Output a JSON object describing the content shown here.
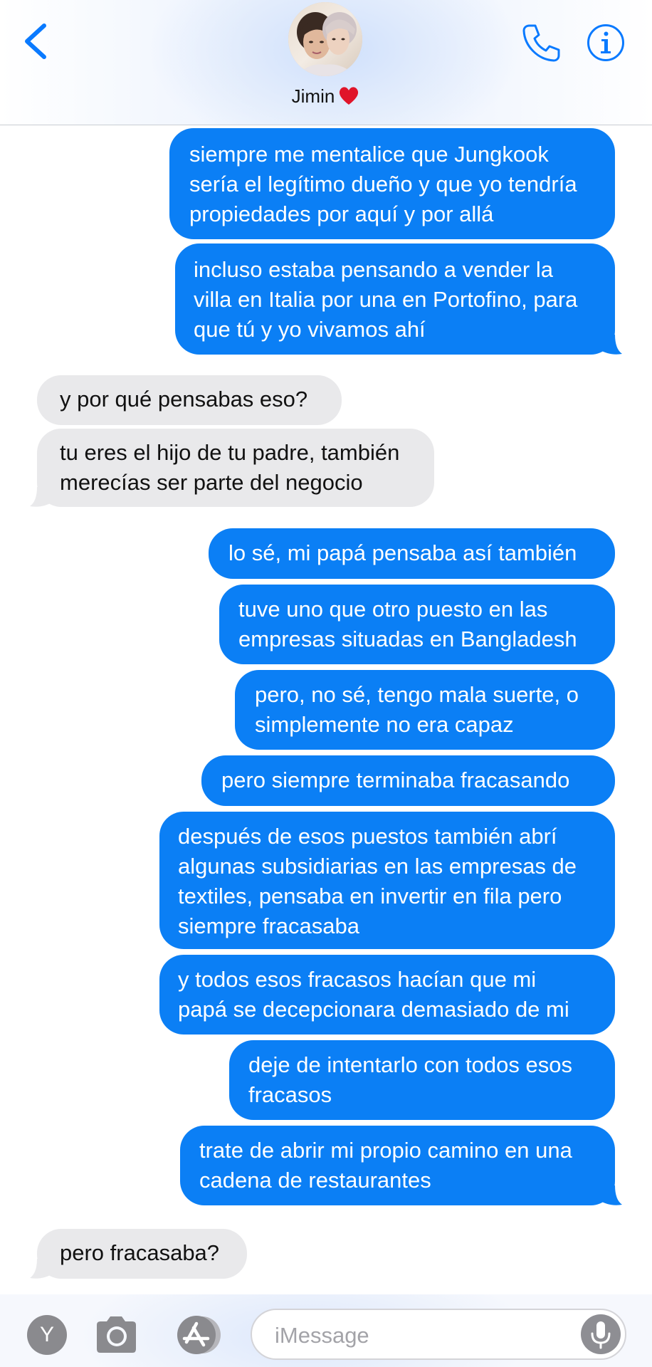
{
  "header": {
    "contact_name": "Jimin",
    "heart_emoji": "heart-emoji",
    "icons": [
      "chevron-left-icon",
      "phone-icon",
      "info-icon"
    ],
    "accent_color": "#0a7aff"
  },
  "messages": [
    {
      "from": "me",
      "lines": [
        "siempre me mentalice que Jungkook",
        "sería el legítimo dueño y que yo tendría",
        "propiedades por aquí y por allá"
      ]
    },
    {
      "from": "me",
      "lines": [
        "incluso estaba pensando a vender la",
        "villa en Italia por una en Portofino, para",
        "que tú y yo vivamos ahí"
      ]
    },
    {
      "from": "them",
      "lines": [
        "y por qué pensabas eso?"
      ]
    },
    {
      "from": "them",
      "lines": [
        "tu eres el hijo de tu padre, también",
        "merecías ser parte del negocio"
      ]
    },
    {
      "from": "me",
      "lines": [
        "lo sé, mi papá pensaba así también"
      ]
    },
    {
      "from": "me",
      "lines": [
        "tuve uno que otro puesto en las",
        "empresas situadas en Bangladesh"
      ]
    },
    {
      "from": "me",
      "lines": [
        "pero, no sé, tengo mala suerte, o",
        "simplemente no era capaz"
      ]
    },
    {
      "from": "me",
      "lines": [
        "pero siempre terminaba fracasando"
      ]
    },
    {
      "from": "me",
      "lines": [
        "después de esos puestos también abrí",
        "algunas subsidiarias en las empresas de",
        "textiles, pensaba en invertir en fila pero",
        "siempre fracasaba"
      ]
    },
    {
      "from": "me",
      "lines": [
        "y todos esos fracasos hacían que mi",
        "papá se decepcionara demasiado de mi"
      ]
    },
    {
      "from": "me",
      "lines": [
        "deje de intentarlo con todos esos",
        "fracasos"
      ]
    },
    {
      "from": "me",
      "lines": [
        "trate de abrir mi propio camino en una",
        "cadena de restaurantes"
      ]
    },
    {
      "from": "them",
      "lines": [
        "pero fracasaba?"
      ]
    }
  ],
  "colors": {
    "sent_bubble": "#0b7ff5",
    "received_bubble": "#e9e9eb"
  },
  "input_bar": {
    "app_button_label": "Y",
    "placeholder": "iMessage",
    "icons": [
      "camera-icon",
      "app-store-icon",
      "microphone-icon"
    ]
  }
}
